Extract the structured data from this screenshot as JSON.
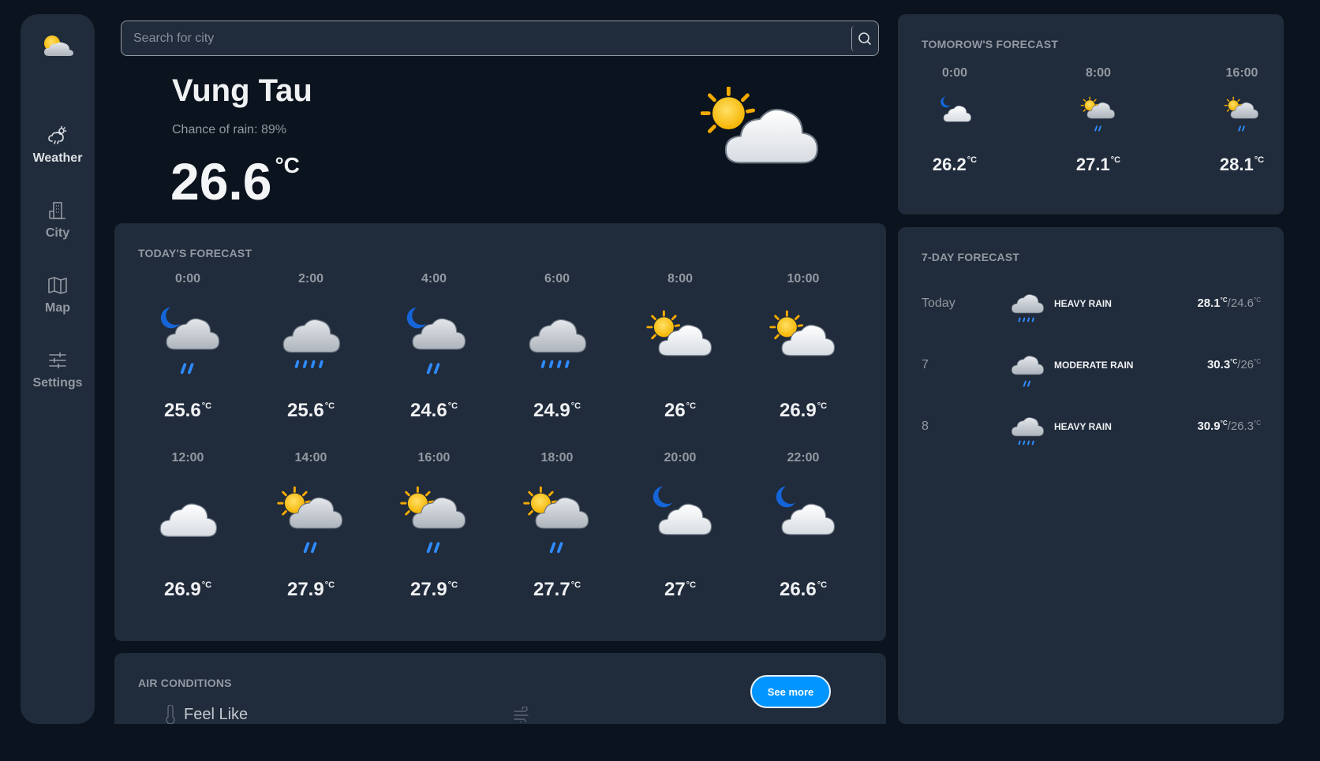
{
  "search": {
    "placeholder": "Search for city"
  },
  "sidebar": {
    "items": [
      {
        "label": "Weather",
        "icon": "weather-icon"
      },
      {
        "label": "City",
        "icon": "city-icon"
      },
      {
        "label": "Map",
        "icon": "map-icon"
      },
      {
        "label": "Settings",
        "icon": "settings-icon"
      }
    ]
  },
  "current": {
    "city": "Vung Tau",
    "rain_chance": "Chance of rain: 89%",
    "temp": "26.6",
    "unit": "°C",
    "icon": "partly-cloudy-sun-icon"
  },
  "today": {
    "title": "TODAY'S FORECAST",
    "hours": [
      {
        "time": "0:00",
        "temp": "25.6",
        "icon": "moon-cloud-rain-icon"
      },
      {
        "time": "2:00",
        "temp": "25.6",
        "icon": "cloud-heavy-rain-icon"
      },
      {
        "time": "4:00",
        "temp": "24.6",
        "icon": "moon-cloud-rain-icon"
      },
      {
        "time": "6:00",
        "temp": "24.9",
        "icon": "cloud-heavy-rain-icon"
      },
      {
        "time": "8:00",
        "temp": "26",
        "icon": "sun-cloud-icon"
      },
      {
        "time": "10:00",
        "temp": "26.9",
        "icon": "sun-cloud-icon"
      },
      {
        "time": "12:00",
        "temp": "26.9",
        "icon": "cloud-icon"
      },
      {
        "time": "14:00",
        "temp": "27.9",
        "icon": "sun-cloud-rain-icon"
      },
      {
        "time": "16:00",
        "temp": "27.9",
        "icon": "sun-cloud-rain-icon"
      },
      {
        "time": "18:00",
        "temp": "27.7",
        "icon": "sun-cloud-rain-icon"
      },
      {
        "time": "20:00",
        "temp": "27",
        "icon": "moon-cloud-icon"
      },
      {
        "time": "22:00",
        "temp": "26.6",
        "icon": "moon-cloud-icon"
      }
    ]
  },
  "air": {
    "title": "AIR CONDITIONS",
    "see_more": "See more",
    "feel_like": "Feel Like"
  },
  "tomorrow": {
    "title": "TOMOROW'S FORECAST",
    "hours": [
      {
        "time": "0:00",
        "temp": "26.2",
        "icon": "moon-cloud-icon"
      },
      {
        "time": "8:00",
        "temp": "27.1",
        "icon": "sun-cloud-rain-icon"
      },
      {
        "time": "16:00",
        "temp": "28.1",
        "icon": "sun-cloud-rain-icon"
      }
    ]
  },
  "week": {
    "title": "7-DAY FORECAST",
    "days": [
      {
        "day": "Today",
        "desc": "HEAVY RAIN",
        "high": "28.1",
        "low": "24.6",
        "icon": "cloud-heavy-rain-icon"
      },
      {
        "day": "7",
        "desc": "MODERATE RAIN",
        "high": "30.3",
        "low": "26",
        "icon": "cloud-rain-icon"
      },
      {
        "day": "8",
        "desc": "HEAVY RAIN",
        "high": "30.9",
        "low": "26.3",
        "icon": "cloud-heavy-rain-icon"
      }
    ]
  },
  "colors": {
    "background": "#0b131e",
    "panel": "#202b3b",
    "accent": "#0095ff",
    "muted": "#9399a2",
    "rain": "#2f8bff",
    "sun": "#ffc400",
    "moon": "#1565d8"
  }
}
